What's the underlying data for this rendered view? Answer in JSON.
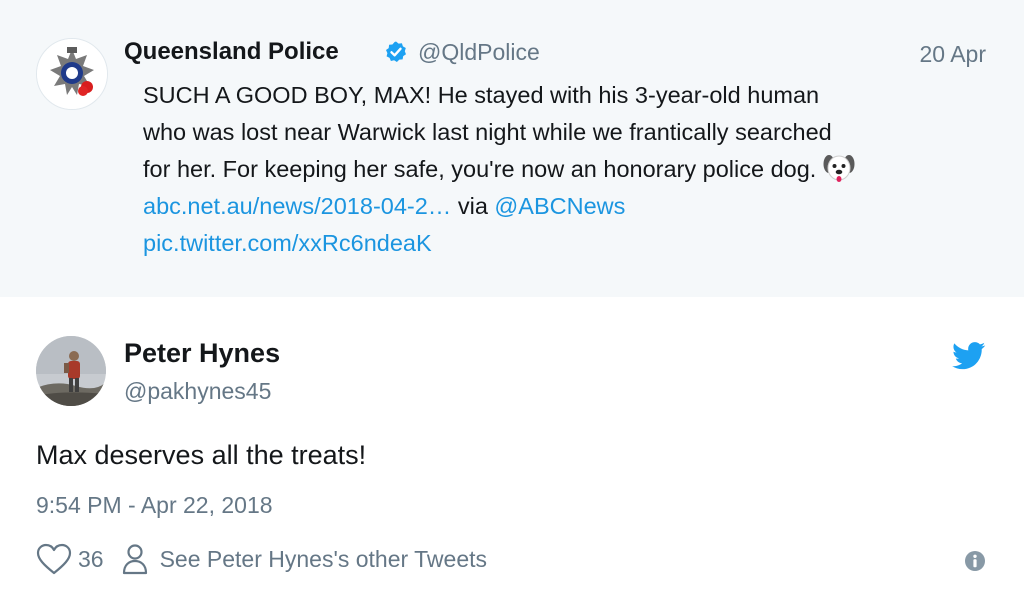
{
  "quoted": {
    "name": "Queensland Police",
    "handle": "@QldPolice",
    "date": "20 Apr",
    "text_lines": [
      "SUCH A GOOD BOY, MAX! He stayed with his 3-year-old human",
      "who was lost near Warwick last night while we frantically searched",
      "for her. For keeping her safe, you're now an honorary police dog."
    ],
    "link": "abc.net.au/news/2018-04-2…",
    "via": "via",
    "mention": "@ABCNews",
    "pic_link": "pic.twitter.com/xxRc6ndeaK",
    "emoji": "dog-face-icon"
  },
  "tweet": {
    "name": "Peter Hynes",
    "handle": "@pakhynes45",
    "text": "Max deserves all the treats!",
    "timestamp": "9:54 PM - Apr 22, 2018",
    "likes": "36",
    "other_tweets": "See Peter Hynes's other Tweets"
  },
  "colors": {
    "link": "#1b95e0",
    "muted": "#657786",
    "quoted_bg": "#f5f8fa",
    "verified": "#1da1f2"
  }
}
